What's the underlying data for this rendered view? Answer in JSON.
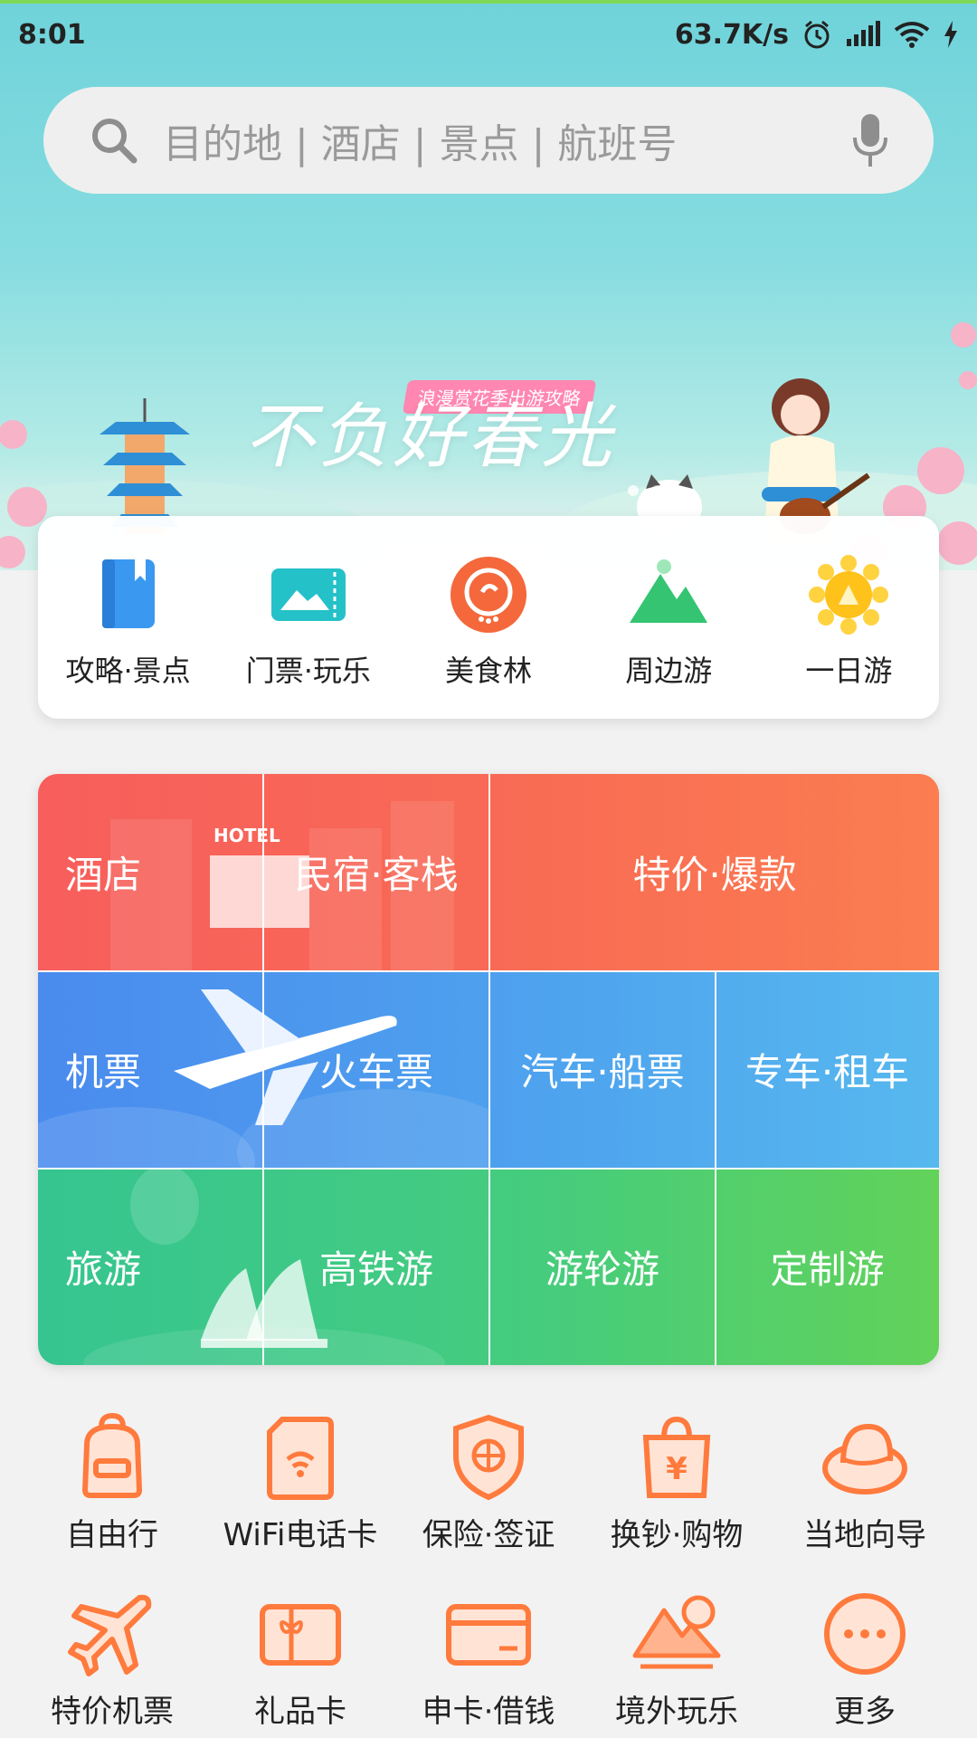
{
  "status_bar": {
    "time": "8:01",
    "speed": "63.7K/s",
    "icons": [
      "alarm-icon",
      "signal-icon",
      "wifi-icon",
      "charging-icon"
    ]
  },
  "search": {
    "placeholder": "目的地 | 酒店 | 景点 | 航班号",
    "icons": [
      "search-icon",
      "microphone-icon"
    ]
  },
  "banner": {
    "tag": "浪漫赏花季出游攻略",
    "title": "不负好春光"
  },
  "quick_nav": [
    {
      "label": "攻略·景点",
      "icon": "guidebook-icon"
    },
    {
      "label": "门票·玩乐",
      "icon": "ticket-icon"
    },
    {
      "label": "美食林",
      "icon": "food-icon"
    },
    {
      "label": "周边游",
      "icon": "mountain-icon"
    },
    {
      "label": "一日游",
      "icon": "sun-icon"
    }
  ],
  "main_grid": {
    "hotel": {
      "hotel": "酒店",
      "homestay": "民宿·客栈",
      "deals": "特价·爆款",
      "sign": "HOTEL"
    },
    "transport": {
      "flight": "机票",
      "train": "火车票",
      "bus_ship": "汽车·船票",
      "car_rental": "专车·租车"
    },
    "travel": {
      "tour": "旅游",
      "hsr_tour": "高铁游",
      "cruise": "游轮游",
      "custom": "定制游"
    },
    "colors": {
      "hotel_row": "#f65f5a",
      "transport_row": "#4f8ff0",
      "travel_row": "#3cc88f"
    }
  },
  "services": [
    {
      "label": "自由行",
      "icon": "backpack-icon"
    },
    {
      "label": "WiFi电话卡",
      "icon": "wifi-card-icon"
    },
    {
      "label": "保险·签证",
      "icon": "shield-icon"
    },
    {
      "label": "换钞·购物",
      "icon": "shopping-bag-icon"
    },
    {
      "label": "当地向导",
      "icon": "guide-hat-icon"
    },
    {
      "label": "特价机票",
      "icon": "airplane-icon"
    },
    {
      "label": "礼品卡",
      "icon": "gift-card-icon"
    },
    {
      "label": "申卡·借钱",
      "icon": "credit-card-icon"
    },
    {
      "label": "境外玩乐",
      "icon": "landscape-icon"
    },
    {
      "label": "更多",
      "icon": "more-icon"
    }
  ],
  "accent_color": "#ff7a3d"
}
